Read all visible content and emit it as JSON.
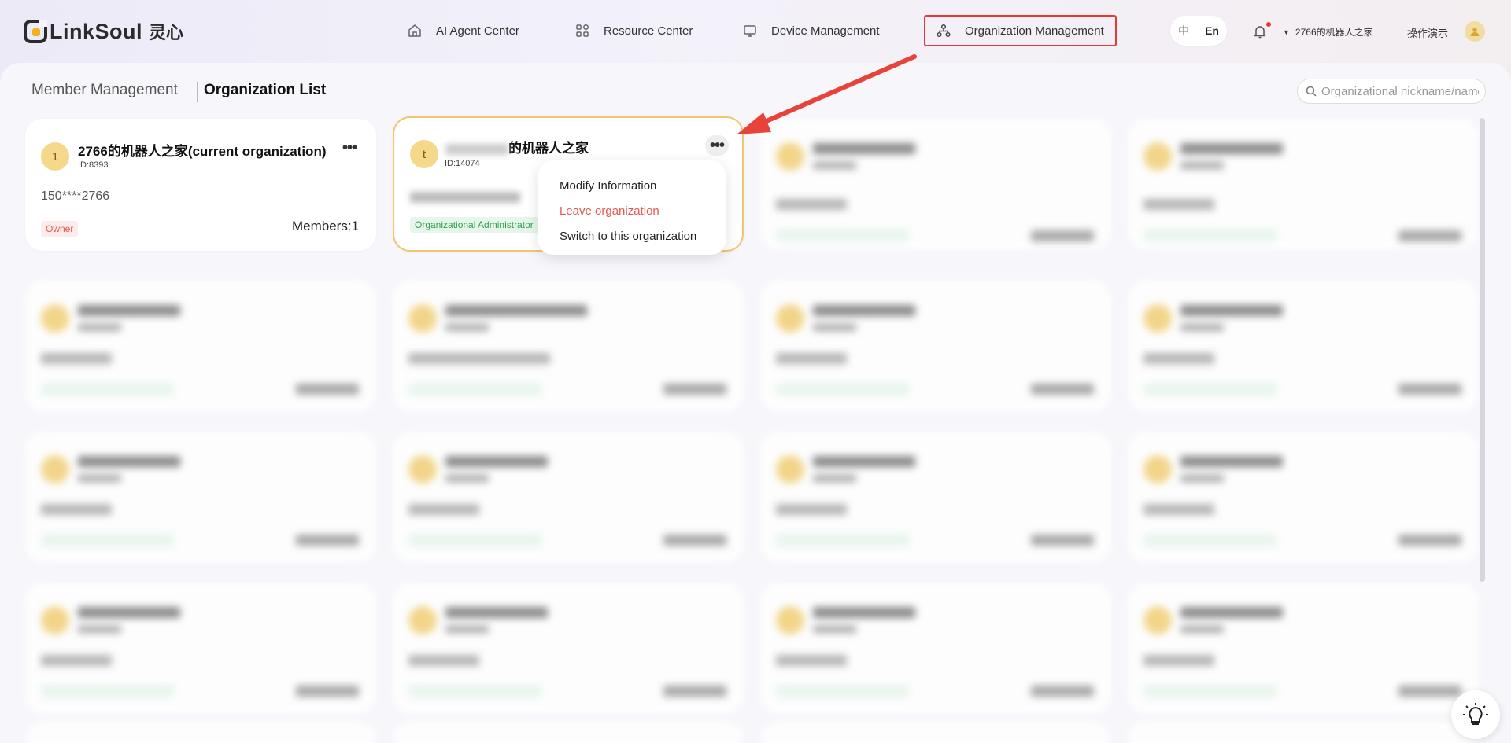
{
  "app": {
    "brand": "LinkSoul",
    "brand_cn": "灵心"
  },
  "nav": [
    {
      "label": "AI Agent Center",
      "icon": "home-icon"
    },
    {
      "label": "Resource Center",
      "icon": "grid-icon"
    },
    {
      "label": "Device Management",
      "icon": "monitor-icon"
    },
    {
      "label": "Organization Management",
      "icon": "org-tree-icon",
      "active": true
    }
  ],
  "lang": {
    "zh": "中",
    "en": "En",
    "selected": "En"
  },
  "header": {
    "current_org": "2766的机器人之家",
    "demo_label": "操作演示",
    "notifications_unread": true
  },
  "tabs": {
    "member": "Member Management",
    "orglist": "Organization List",
    "selected": "Organization List"
  },
  "search": {
    "placeholder": "Organizational nickname/name"
  },
  "cards": [
    {
      "avatar": "1",
      "name": "2766的机器人之家(current organization)",
      "id": "ID:8393",
      "phone": "150****2766",
      "role": "Owner",
      "members": "Members:1"
    },
    {
      "avatar": "t",
      "name": "的机器人之家",
      "id": "ID:14074",
      "role": "Organizational Administrator",
      "selected": true
    }
  ],
  "dropdown": {
    "items": [
      {
        "label": "Modify Information"
      },
      {
        "label": "Leave organization",
        "danger": true
      },
      {
        "label": "Switch to this organization"
      }
    ]
  },
  "colors": {
    "active_border": "#e53935",
    "card_highlight": "#f4c56f",
    "owner_badge": "#e05a4f",
    "admin_badge": "#2ca24a",
    "avatar_bg": "#f5d889"
  }
}
